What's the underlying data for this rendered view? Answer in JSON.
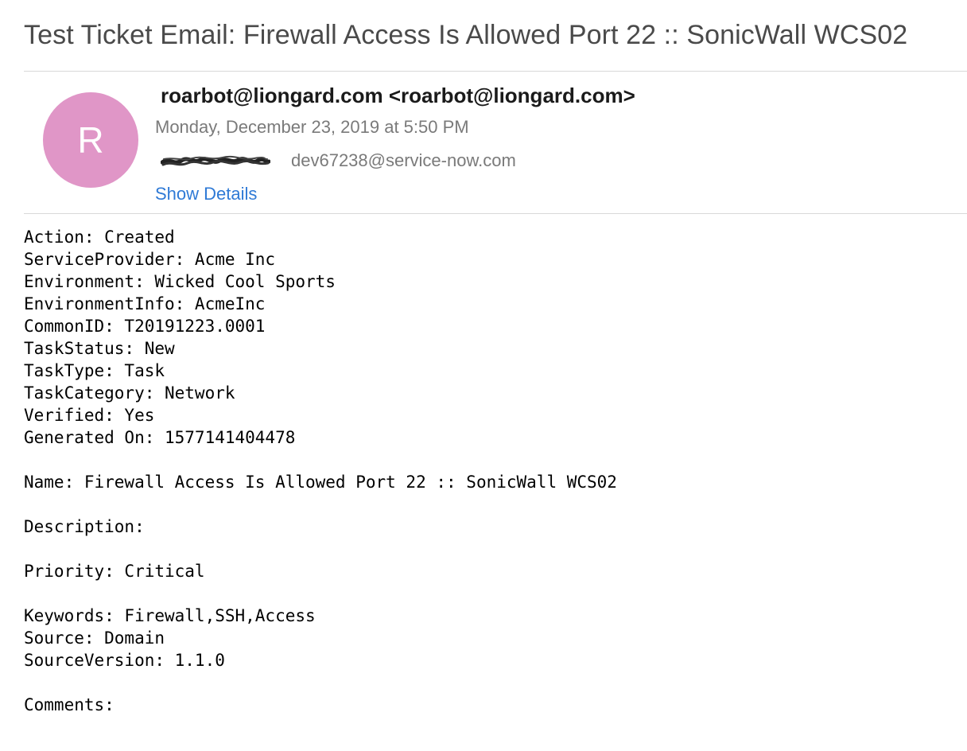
{
  "email": {
    "subject": "Test Ticket Email: Firewall Access Is Allowed Port 22 :: SonicWall WCS02",
    "avatar_initial": "R",
    "avatar_color": "#e096c7",
    "from": "roarbot@liongard.com <roarbot@liongard.com>",
    "date": "Monday, December 23, 2019 at 5:50 PM",
    "to_email": "dev67238@service-now.com",
    "show_details_label": "Show Details",
    "link_color": "#2f7ad6"
  },
  "body_lines": [
    "Action: Created",
    "ServiceProvider: Acme Inc",
    "Environment: Wicked Cool Sports",
    "EnvironmentInfo: AcmeInc",
    "CommonID: T20191223.0001",
    "TaskStatus: New",
    "TaskType: Task",
    "TaskCategory: Network",
    "Verified: Yes",
    "Generated On: 1577141404478",
    "",
    "Name: Firewall Access Is Allowed Port 22 :: SonicWall WCS02",
    "",
    "Description:",
    "",
    "Priority: Critical",
    "",
    "Keywords: Firewall,SSH,Access",
    "Source: Domain",
    "SourceVersion: 1.1.0",
    "",
    "Comments:"
  ]
}
